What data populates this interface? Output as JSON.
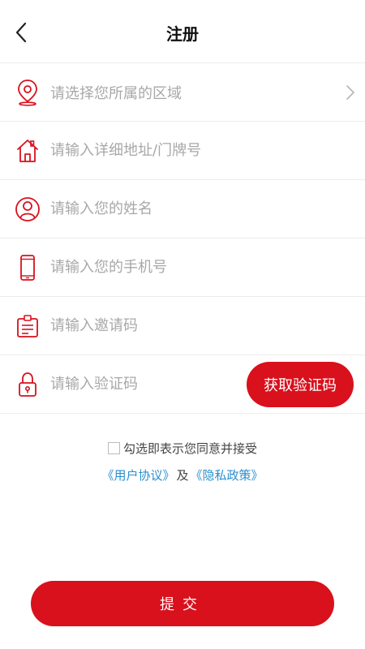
{
  "header": {
    "title": "注册"
  },
  "form": {
    "region_placeholder": "请选择您所属的区域",
    "address_placeholder": "请输入详细地址/门牌号",
    "name_placeholder": "请输入您的姓名",
    "phone_placeholder": "请输入您的手机号",
    "invite_placeholder": "请输入邀请码",
    "code_placeholder": "请输入验证码",
    "get_code_label": "获取验证码"
  },
  "agreement": {
    "text": "勾选即表示您同意并接受",
    "user_agreement": "《用户协议》",
    "and": "及",
    "privacy_policy": "《隐私政策》"
  },
  "submit_label": "提交",
  "icons": {
    "back": "chevron-left-icon",
    "region": "location-pin-icon",
    "address": "home-icon",
    "name": "user-icon",
    "phone": "phone-icon",
    "invite": "badge-icon",
    "code": "lock-icon",
    "chevron": "chevron-right-icon"
  },
  "colors": {
    "accent": "#d8111d",
    "link": "#2a8fcf",
    "placeholder": "#a8a8a8"
  }
}
